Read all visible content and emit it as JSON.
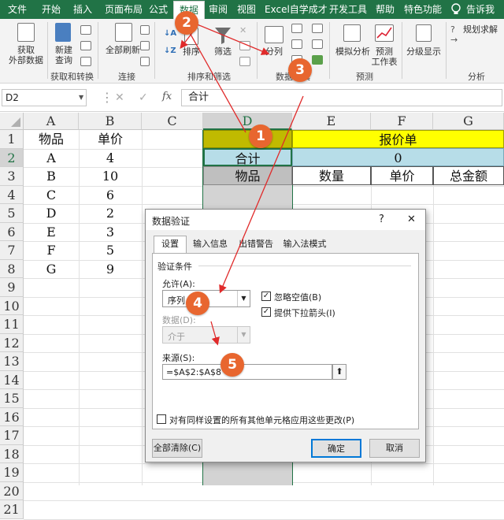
{
  "ribbon": {
    "tabs": [
      "文件",
      "开始",
      "插入",
      "页面布局",
      "公式",
      "数据",
      "审阅",
      "视图",
      "Excel自学成才",
      "开发工具",
      "帮助",
      "特色功能",
      "告诉我"
    ],
    "buttons": {
      "get_data": "获取\n外部数据",
      "new_query": "新建\n查询",
      "refresh_all": "全部刷新",
      "sort": "排序",
      "filter": "筛选",
      "split": "分列",
      "what_if": "模拟分析",
      "forecast": "预测\n工作表",
      "outline": "分级显示",
      "solver": "规划求解"
    },
    "groups": [
      "获取和转换",
      "连接",
      "排序和筛选",
      "数据工具",
      "预测",
      "分析"
    ]
  },
  "formula_bar": {
    "name_box": "D2",
    "cancel": "✕",
    "confirm": "✓",
    "fx": "fx",
    "value": "合计"
  },
  "sheet": {
    "columns": [
      "A",
      "B",
      "C",
      "D",
      "E",
      "F",
      "G"
    ],
    "rows": [
      "1",
      "2",
      "3",
      "4",
      "5",
      "6",
      "7",
      "8",
      "9",
      "10",
      "11",
      "12",
      "13",
      "14",
      "15",
      "16",
      "17",
      "18",
      "19",
      "20",
      "21"
    ],
    "list_header": [
      "物品",
      "单价"
    ],
    "items": [
      [
        "A",
        "4"
      ],
      [
        "B",
        "10"
      ],
      [
        "C",
        "6"
      ],
      [
        "D",
        "2"
      ],
      [
        "E",
        "3"
      ],
      [
        "F",
        "5"
      ],
      [
        "G",
        "9"
      ]
    ],
    "quote_title": "报价单",
    "total_label": "合计",
    "total_value": "0",
    "table_headers": [
      "物品",
      "数量",
      "单价",
      "总金额"
    ]
  },
  "dialog": {
    "title": "数据验证",
    "help": "?",
    "close": "✕",
    "tabs": [
      "设置",
      "输入信息",
      "出错警告",
      "输入法模式"
    ],
    "section": "验证条件",
    "allow_label": "允许(A):",
    "allow_value": "序列",
    "data_label": "数据(D):",
    "data_value": "介于",
    "ignore_blank": "忽略空值(B)",
    "dropdown": "提供下拉箭头(I)",
    "source_label": "来源(S):",
    "source_value": "=$A$2:$A$8",
    "apply_all": "对有同样设置的所有其他单元格应用这些更改(P)",
    "clear_all": "全部清除(C)",
    "ok": "确定",
    "cancel": "取消"
  },
  "badges": [
    "1",
    "2",
    "3",
    "4",
    "5"
  ],
  "colors": {
    "excel_green": "#217346",
    "yellow": "#ffff00",
    "olive": "#c0ba00",
    "light_blue": "#b7dde8",
    "gray": "#bfbfbf",
    "badge": "#e8662f",
    "arrow": "#e02a2a"
  }
}
